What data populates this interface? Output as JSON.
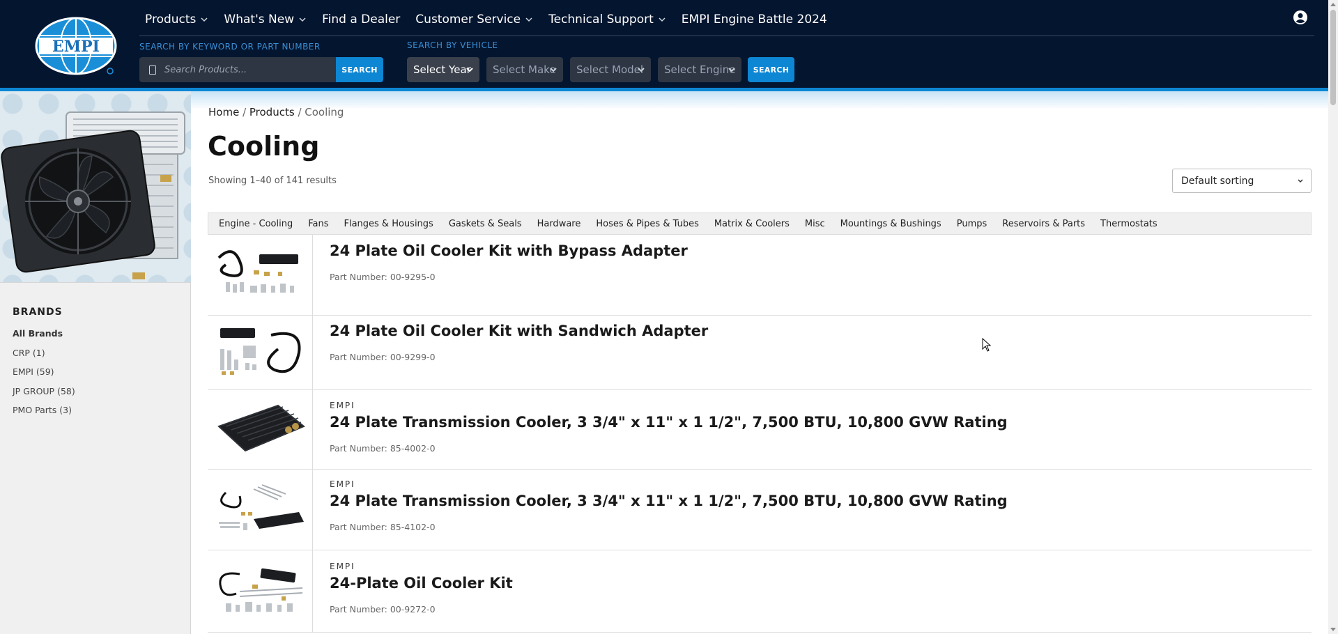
{
  "header": {
    "logo_text": "EMPI",
    "nav": [
      {
        "label": "Products",
        "dropdown": true
      },
      {
        "label": "What's New",
        "dropdown": true
      },
      {
        "label": "Find a Dealer",
        "dropdown": false
      },
      {
        "label": "Customer Service",
        "dropdown": true
      },
      {
        "label": "Technical Support",
        "dropdown": true
      },
      {
        "label": "EMPI Engine Battle 2024",
        "dropdown": false
      }
    ],
    "keyword_search": {
      "label": "SEARCH BY KEYWORD OR PART NUMBER",
      "placeholder": "Search Products...",
      "button": "SEARCH"
    },
    "vehicle_search": {
      "label": "SEARCH BY VEHICLE",
      "year": "Select Year",
      "make": "Select Make",
      "model": "Select Model",
      "engine": "Select Engine",
      "button": "SEARCH"
    }
  },
  "sidebar": {
    "brands_title": "BRANDS",
    "brands": [
      {
        "label": "All Brands",
        "active": true
      },
      {
        "label": "CRP  (1)"
      },
      {
        "label": "EMPI  (59)"
      },
      {
        "label": "JP GROUP  (58)"
      },
      {
        "label": "PMO Parts  (3)"
      }
    ]
  },
  "main": {
    "breadcrumb": {
      "home": "Home",
      "sep1": " / ",
      "products": "Products",
      "sep2": " / ",
      "current": "Cooling"
    },
    "title": "Cooling",
    "result_count": "Showing 1–40 of 141 results",
    "sorting": "Default sorting",
    "categories": [
      "Engine - Cooling",
      "Fans",
      "Flanges & Housings",
      "Gaskets & Seals",
      "Hardware",
      "Hoses & Pipes & Tubes",
      "Matrix & Coolers",
      "Misc",
      "Mountings & Bushings",
      "Pumps",
      "Reservoirs & Parts",
      "Thermostats"
    ],
    "products": [
      {
        "brand": "",
        "name": "24 Plate Oil Cooler Kit with Bypass Adapter",
        "part": "Part Number: 00-9295-0"
      },
      {
        "brand": "",
        "name": "24 Plate Oil Cooler Kit with Sandwich Adapter",
        "part": "Part Number: 00-9299-0"
      },
      {
        "brand": "EMPI",
        "name": "24 Plate Transmission Cooler, 3 3/4\" x 11\" x 1 1/2\", 7,500 BTU, 10,800 GVW Rating",
        "part": "Part Number: 85-4002-0"
      },
      {
        "brand": "EMPI",
        "name": "24 Plate Transmission Cooler, 3 3/4\" x 11\" x 1 1/2\", 7,500 BTU, 10,800 GVW Rating",
        "part": "Part Number: 85-4102-0"
      },
      {
        "brand": "EMPI",
        "name": "24-Plate Oil Cooler Kit",
        "part": "Part Number: 00-9272-0"
      }
    ]
  },
  "colors": {
    "header_bg": "#04152f",
    "accent": "#0d86d4",
    "sidebar_bg": "#f0f0f0"
  }
}
